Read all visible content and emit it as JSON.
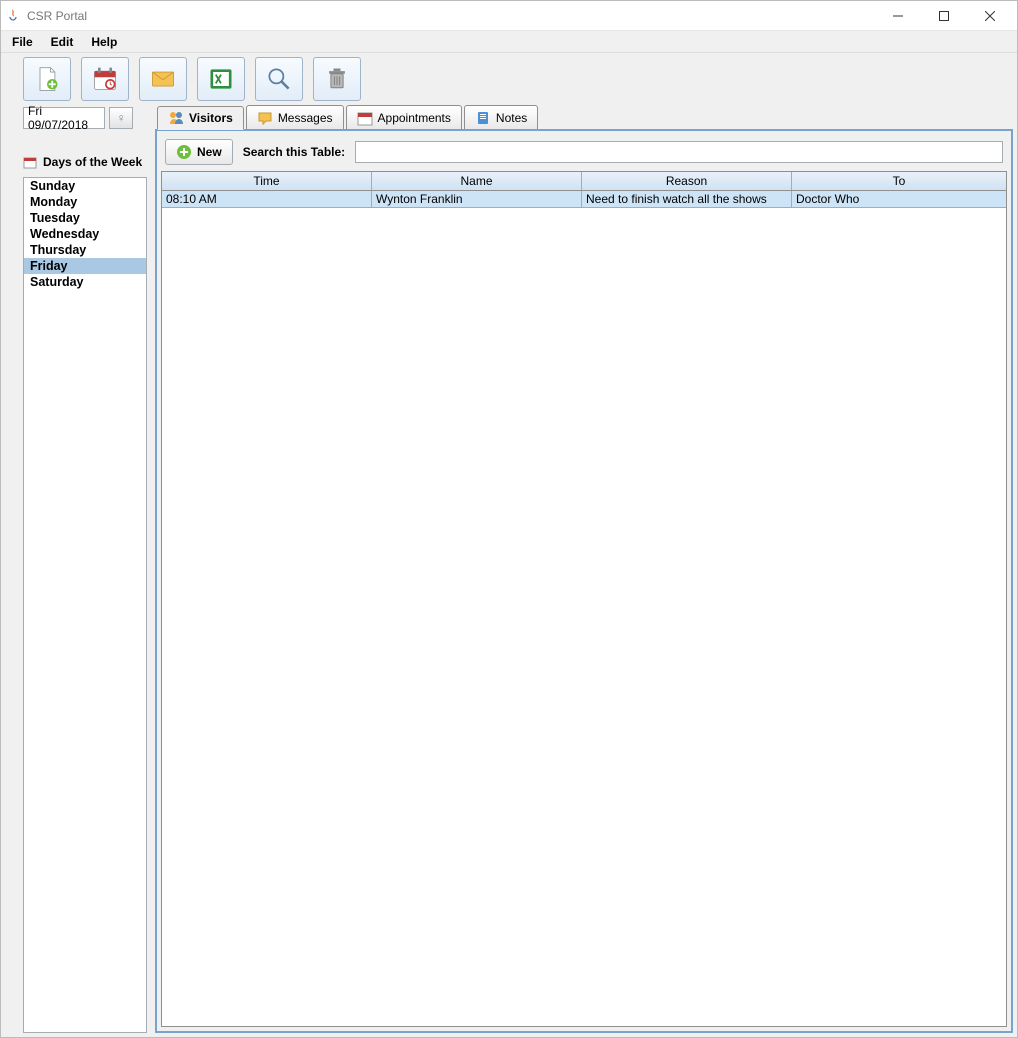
{
  "window": {
    "title": "CSR Portal"
  },
  "menu": {
    "file": "File",
    "edit": "Edit",
    "help": "Help"
  },
  "date": {
    "value": "Fri 09/07/2018"
  },
  "sidebar": {
    "header": "Days of the Week",
    "days": [
      "Sunday",
      "Monday",
      "Tuesday",
      "Wednesday",
      "Thursday",
      "Friday",
      "Saturday"
    ],
    "selected_index": 5
  },
  "tabs": {
    "items": [
      {
        "label": "Visitors"
      },
      {
        "label": "Messages"
      },
      {
        "label": "Appointments"
      },
      {
        "label": "Notes"
      }
    ],
    "active_index": 0
  },
  "search": {
    "new_label": "New",
    "label": "Search this Table:",
    "value": ""
  },
  "table": {
    "columns": [
      "Time",
      "Name",
      "Reason",
      "To"
    ],
    "rows": [
      {
        "time": "08:10 AM",
        "name": "Wynton Franklin",
        "reason": "Need to finish watch all the shows",
        "to": "Doctor Who"
      }
    ]
  }
}
